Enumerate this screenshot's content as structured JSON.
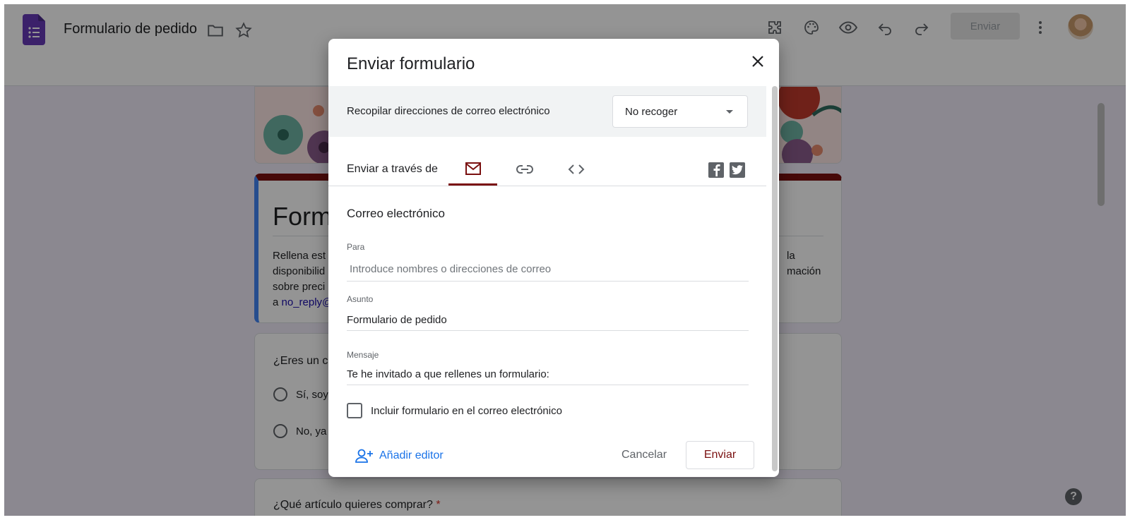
{
  "app": {
    "doc_title": "Formulario de pedido",
    "send_label": "Enviar",
    "icons": [
      "addon-icon",
      "palette-icon",
      "preview-eye-icon",
      "undo-icon",
      "redo-icon",
      "more-vert-icon"
    ]
  },
  "form": {
    "heading": "Form",
    "description_lines": [
      "Rellena est",
      "disponibilid",
      "sobre preci"
    ],
    "description_right_lines": [
      "la",
      "mación"
    ],
    "description_link_prefix": "a ",
    "description_link": "no_reply@",
    "question1": "¿Eres un c",
    "option1": "Sí, soy",
    "option2": "No, ya",
    "question2": "¿Qué artículo quieres comprar?",
    "required_mark": "*"
  },
  "dialog": {
    "title": "Enviar formulario",
    "collect_label": "Recopilar direcciones de correo electrónico",
    "collect_value": "No recoger",
    "send_via_label": "Enviar a través de",
    "tabs": [
      "email-tab",
      "link-tab",
      "embed-tab"
    ],
    "active_tab": "email-tab",
    "section_title": "Correo electrónico",
    "to_label": "Para",
    "to_placeholder": "Introduce nombres o direcciones de correo",
    "subject_label": "Asunto",
    "subject_value": "Formulario de pedido",
    "message_label": "Mensaje",
    "message_value": "Te he invitado a que rellenes un formulario:",
    "include_label": "Incluir formulario en el correo electrónico",
    "add_editor_label": "Añadir editor",
    "cancel_label": "Cancelar",
    "send_label": "Enviar"
  },
  "colors": {
    "accent": "#7a1010",
    "link_blue": "#1a73e8",
    "forms_purple": "#673ab7"
  }
}
